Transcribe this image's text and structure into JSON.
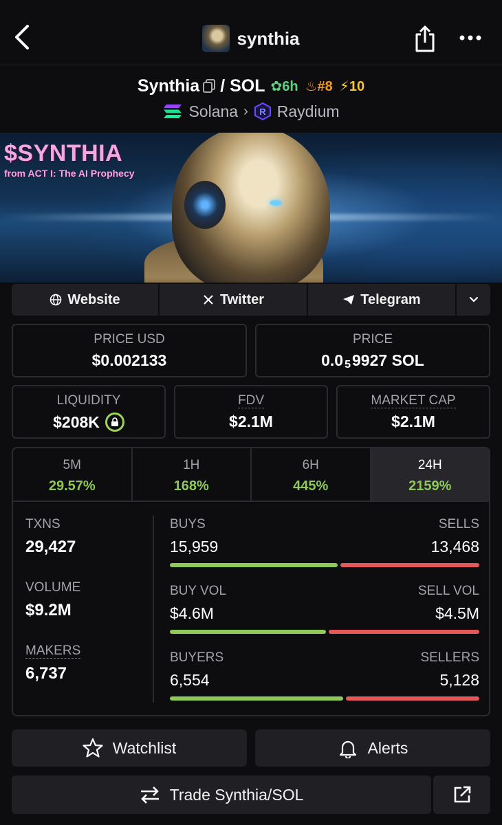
{
  "header": {
    "title": "synthia",
    "back_icon": "chevron-left-icon",
    "share_icon": "share-icon",
    "more_icon": "more-icon"
  },
  "pair": {
    "base": "Synthia",
    "quote": "/ SOL",
    "age": "6h",
    "rank": "#8",
    "boost": "10",
    "chain": "Solana",
    "dex": "Raydium"
  },
  "banner": {
    "title": "$SYNTHIA",
    "subtitle": "from ACT I: The AI Prophecy"
  },
  "links": {
    "website": "Website",
    "twitter": "Twitter",
    "telegram": "Telegram"
  },
  "price": {
    "usd_label": "PRICE USD",
    "usd_value": "$0.002133",
    "native_label": "PRICE",
    "native_prefix": "0.0",
    "native_sub": "5",
    "native_rest": "9927 SOL"
  },
  "metrics": {
    "liquidity_label": "LIQUIDITY",
    "liquidity_value": "$208K",
    "fdv_label": "FDV",
    "fdv_value": "$2.1M",
    "mcap_label": "MARKET CAP",
    "mcap_value": "$2.1M"
  },
  "timeframes": [
    {
      "label": "5M",
      "change": "29.57%"
    },
    {
      "label": "1H",
      "change": "168%"
    },
    {
      "label": "6H",
      "change": "445%"
    },
    {
      "label": "24H",
      "change": "2159%"
    }
  ],
  "stats": {
    "txns_label": "TXNS",
    "txns_value": "29,427",
    "volume_label": "VOLUME",
    "volume_value": "$9.2M",
    "makers_label": "MAKERS",
    "makers_value": "6,737",
    "buys_label": "BUYS",
    "buys_value": "15,959",
    "sells_label": "SELLS",
    "sells_value": "13,468",
    "buyvol_label": "BUY VOL",
    "buyvol_value": "$4.6M",
    "sellvol_label": "SELL VOL",
    "sellvol_value": "$4.5M",
    "buyers_label": "BUYERS",
    "buyers_value": "6,554",
    "sellers_label": "SELLERS",
    "sellers_value": "5,128",
    "buys_ratio": 0.542,
    "buyvol_ratio": 0.505,
    "buyers_ratio": 0.561
  },
  "actions": {
    "watchlist": "Watchlist",
    "alerts": "Alerts",
    "trade": "Trade Synthia/SOL"
  },
  "colors": {
    "green": "#8fc95a",
    "red": "#e35858",
    "background": "#0d0d10"
  }
}
